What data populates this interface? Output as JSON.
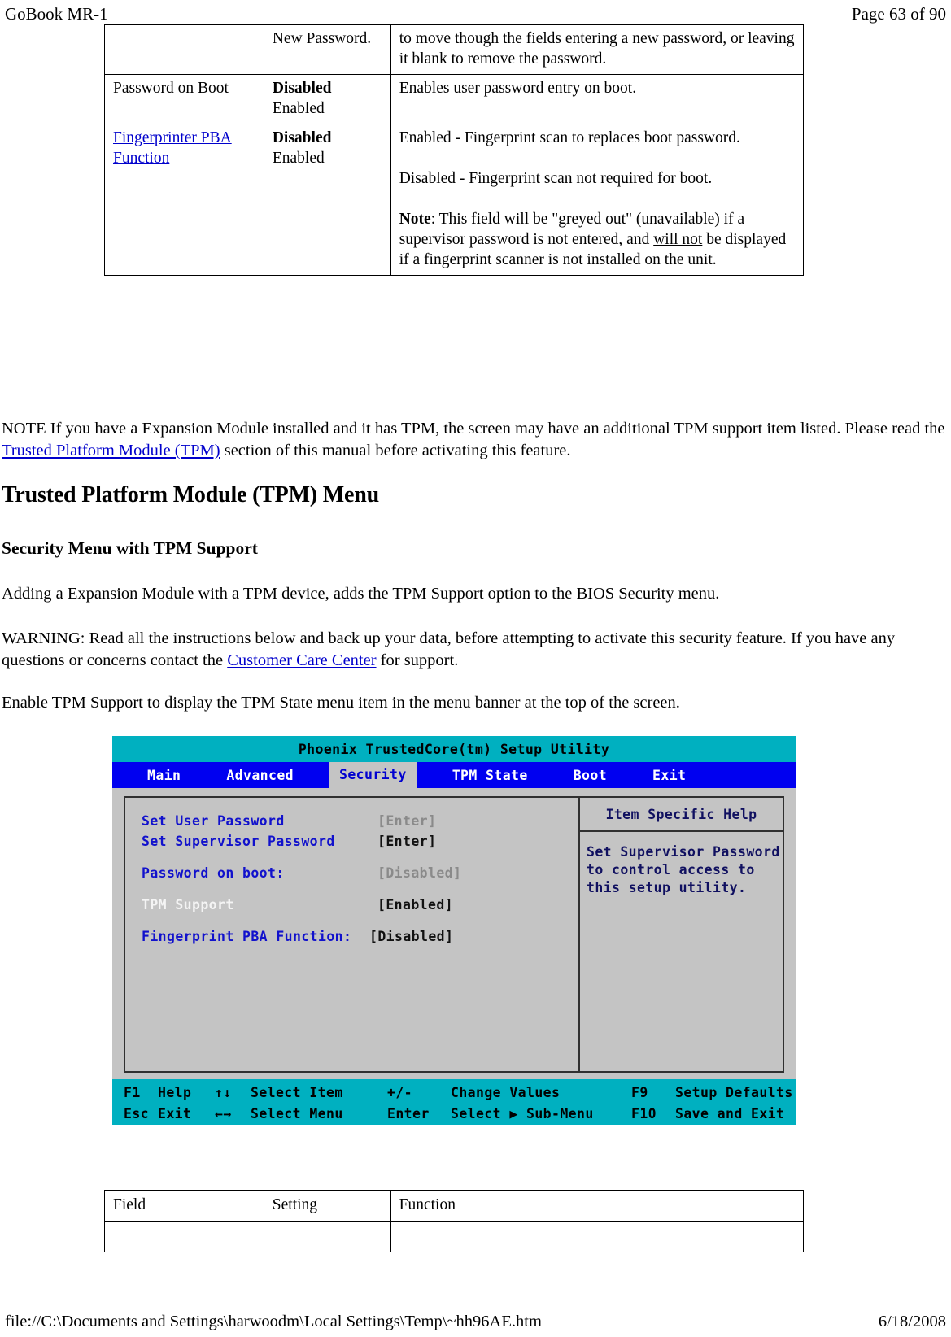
{
  "header": {
    "title": "GoBook MR-1",
    "page_label": "Page 63 of 90"
  },
  "top_table": {
    "rows": [
      {
        "field": "",
        "setting": "New Password.",
        "function": "to move though the fields entering a new password, or leaving it blank to remove the password."
      },
      {
        "field": "Password on Boot",
        "setting_bold": "Disabled",
        "setting_plain": "Enabled",
        "function": "Enables user  password entry on boot."
      },
      {
        "field_link": "Fingerprinter PBA Function",
        "setting_bold": "Disabled",
        "setting_plain": "Enabled",
        "function_p1": "Enabled - Fingerprint scan to replaces boot password.",
        "function_p2": "Disabled - Fingerprint scan not required for boot.",
        "function_note_label": "Note",
        "function_p3_a": ": This field will be \"greyed out\" (unavailable) if a supervisor password is not entered, and ",
        "function_p3_u": "will not",
        "function_p3_b": " be displayed if a fingerprint scanner is not installed on the unit."
      }
    ]
  },
  "note_paragraph": {
    "part1": "NOTE If you have a Expansion Module installed and it has TPM, the screen may have an additional TPM support item listed.  Please read the",
    "link": " Trusted Platform Module (TPM)",
    "part2": " section of this manual before activating this feature."
  },
  "section_title": "Trusted Platform Module (TPM) Menu",
  "subsection_title": "Security Menu with TPM Support",
  "para_adding": "Adding a Expansion Module with a TPM device, adds the TPM Support option to the BIOS Security menu.",
  "warning": {
    "part1": "WARNING: Read all the instructions below and back up your data, before attempting to activate this security feature.  If you have any questions or concerns contact the ",
    "link": "Customer Care Center",
    "part2": " for support."
  },
  "para_enable": " Enable TPM Support to display the TPM State menu item in the menu banner at the top of the screen.",
  "bios": {
    "title": "Phoenix TrustedCore(tm) Setup Utility",
    "menu": [
      {
        "label": "Main",
        "active": false
      },
      {
        "label": "Advanced",
        "active": false
      },
      {
        "label": "Security",
        "active": true
      },
      {
        "label": "TPM State",
        "active": false
      },
      {
        "label": "Boot",
        "active": false
      },
      {
        "label": "Exit",
        "active": false
      }
    ],
    "options": [
      {
        "label": "Set User Password",
        "value": "[Enter]",
        "value_style": "grey",
        "label_style": "blue"
      },
      {
        "label": "Set Supervisor Password",
        "value": "[Enter]",
        "value_style": "dark",
        "label_style": "blue"
      },
      {
        "label": "Password on boot:",
        "value": "[Disabled]",
        "value_style": "grey",
        "label_style": "blue"
      },
      {
        "label": "TPM Support",
        "value": "[Enabled]",
        "value_style": "dark",
        "label_style": "white"
      },
      {
        "label": "Fingerprint PBA Function:",
        "value": "[Disabled]",
        "value_style": "dark",
        "label_style": "blue"
      }
    ],
    "help_title": "Item Specific Help",
    "help_lines": [
      "Set Supervisor Password",
      "to control access to",
      "this setup utility."
    ],
    "function_keys_row1": [
      {
        "key": "F1",
        "desc": "Help"
      },
      {
        "key": "↑↓",
        "desc": "Select Item"
      },
      {
        "key": "+/-",
        "desc": "Change Values"
      },
      {
        "key": "F9",
        "desc": "Setup Defaults"
      }
    ],
    "function_keys_row2": [
      {
        "key": "Esc",
        "desc": "Exit"
      },
      {
        "key": "←→",
        "desc": "Select Menu"
      },
      {
        "key": "Enter",
        "desc": "Select ▶ Sub-Menu"
      },
      {
        "key": "F10",
        "desc": "Save and Exit"
      }
    ],
    "colors": {
      "title_bar": "#00b0c0",
      "menu_bar": "#0000f0",
      "panel": "#c4c4c4",
      "label_blue": "#1111cc",
      "value_grey": "#8a8a8a"
    }
  },
  "bottom_table": {
    "headers": [
      "Field",
      "Setting",
      "Function"
    ]
  },
  "footer": {
    "path": "file://C:\\Documents and Settings\\harwoodm\\Local Settings\\Temp\\~hh96AE.htm",
    "date": "6/18/2008"
  }
}
